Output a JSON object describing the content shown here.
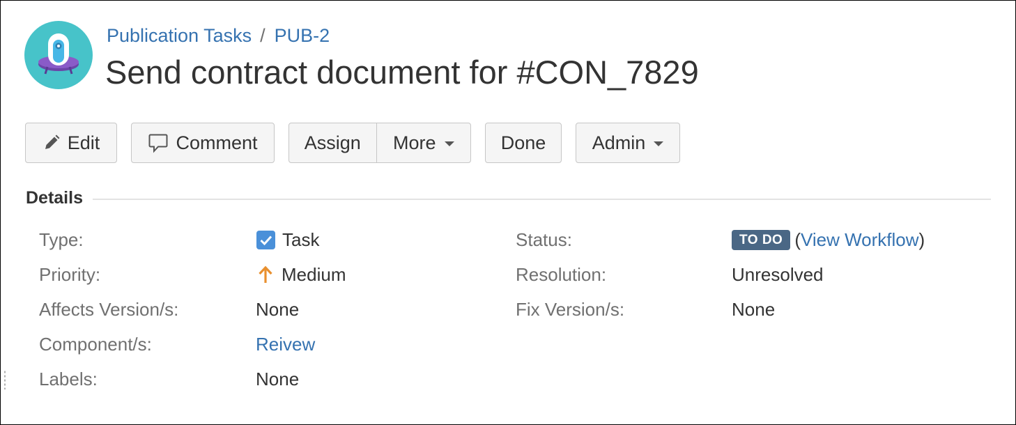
{
  "breadcrumb": {
    "project": "Publication Tasks",
    "separator": "/",
    "issue_key": "PUB-2"
  },
  "issue": {
    "title": "Send contract document for #CON_7829"
  },
  "toolbar": {
    "edit": "Edit",
    "comment": "Comment",
    "assign": "Assign",
    "more": "More",
    "done": "Done",
    "admin": "Admin"
  },
  "details": {
    "heading": "Details",
    "left": {
      "type_label": "Type:",
      "type_value": "Task",
      "priority_label": "Priority:",
      "priority_value": "Medium",
      "affects_label": "Affects Version/s:",
      "affects_value": "None",
      "component_label": "Component/s:",
      "component_value": "Reivew",
      "labels_label": "Labels:",
      "labels_value": "None"
    },
    "right": {
      "status_label": "Status:",
      "status_value": "TO DO",
      "workflow_open": "(",
      "workflow_link": "View Workflow",
      "workflow_close": ")",
      "resolution_label": "Resolution:",
      "resolution_value": "Unresolved",
      "fix_label": "Fix Version/s:",
      "fix_value": "None"
    }
  },
  "icons": {
    "avatar": "project-avatar-icon",
    "edit": "pencil-icon",
    "comment": "comment-icon",
    "type": "task-checkbox-icon",
    "priority": "arrow-up-icon"
  },
  "colors": {
    "link": "#3572b0",
    "status_lozenge": "#4a6785",
    "task_icon": "#4a90d9",
    "priority_medium": "#e8902f",
    "button_bg": "#f5f5f5"
  }
}
